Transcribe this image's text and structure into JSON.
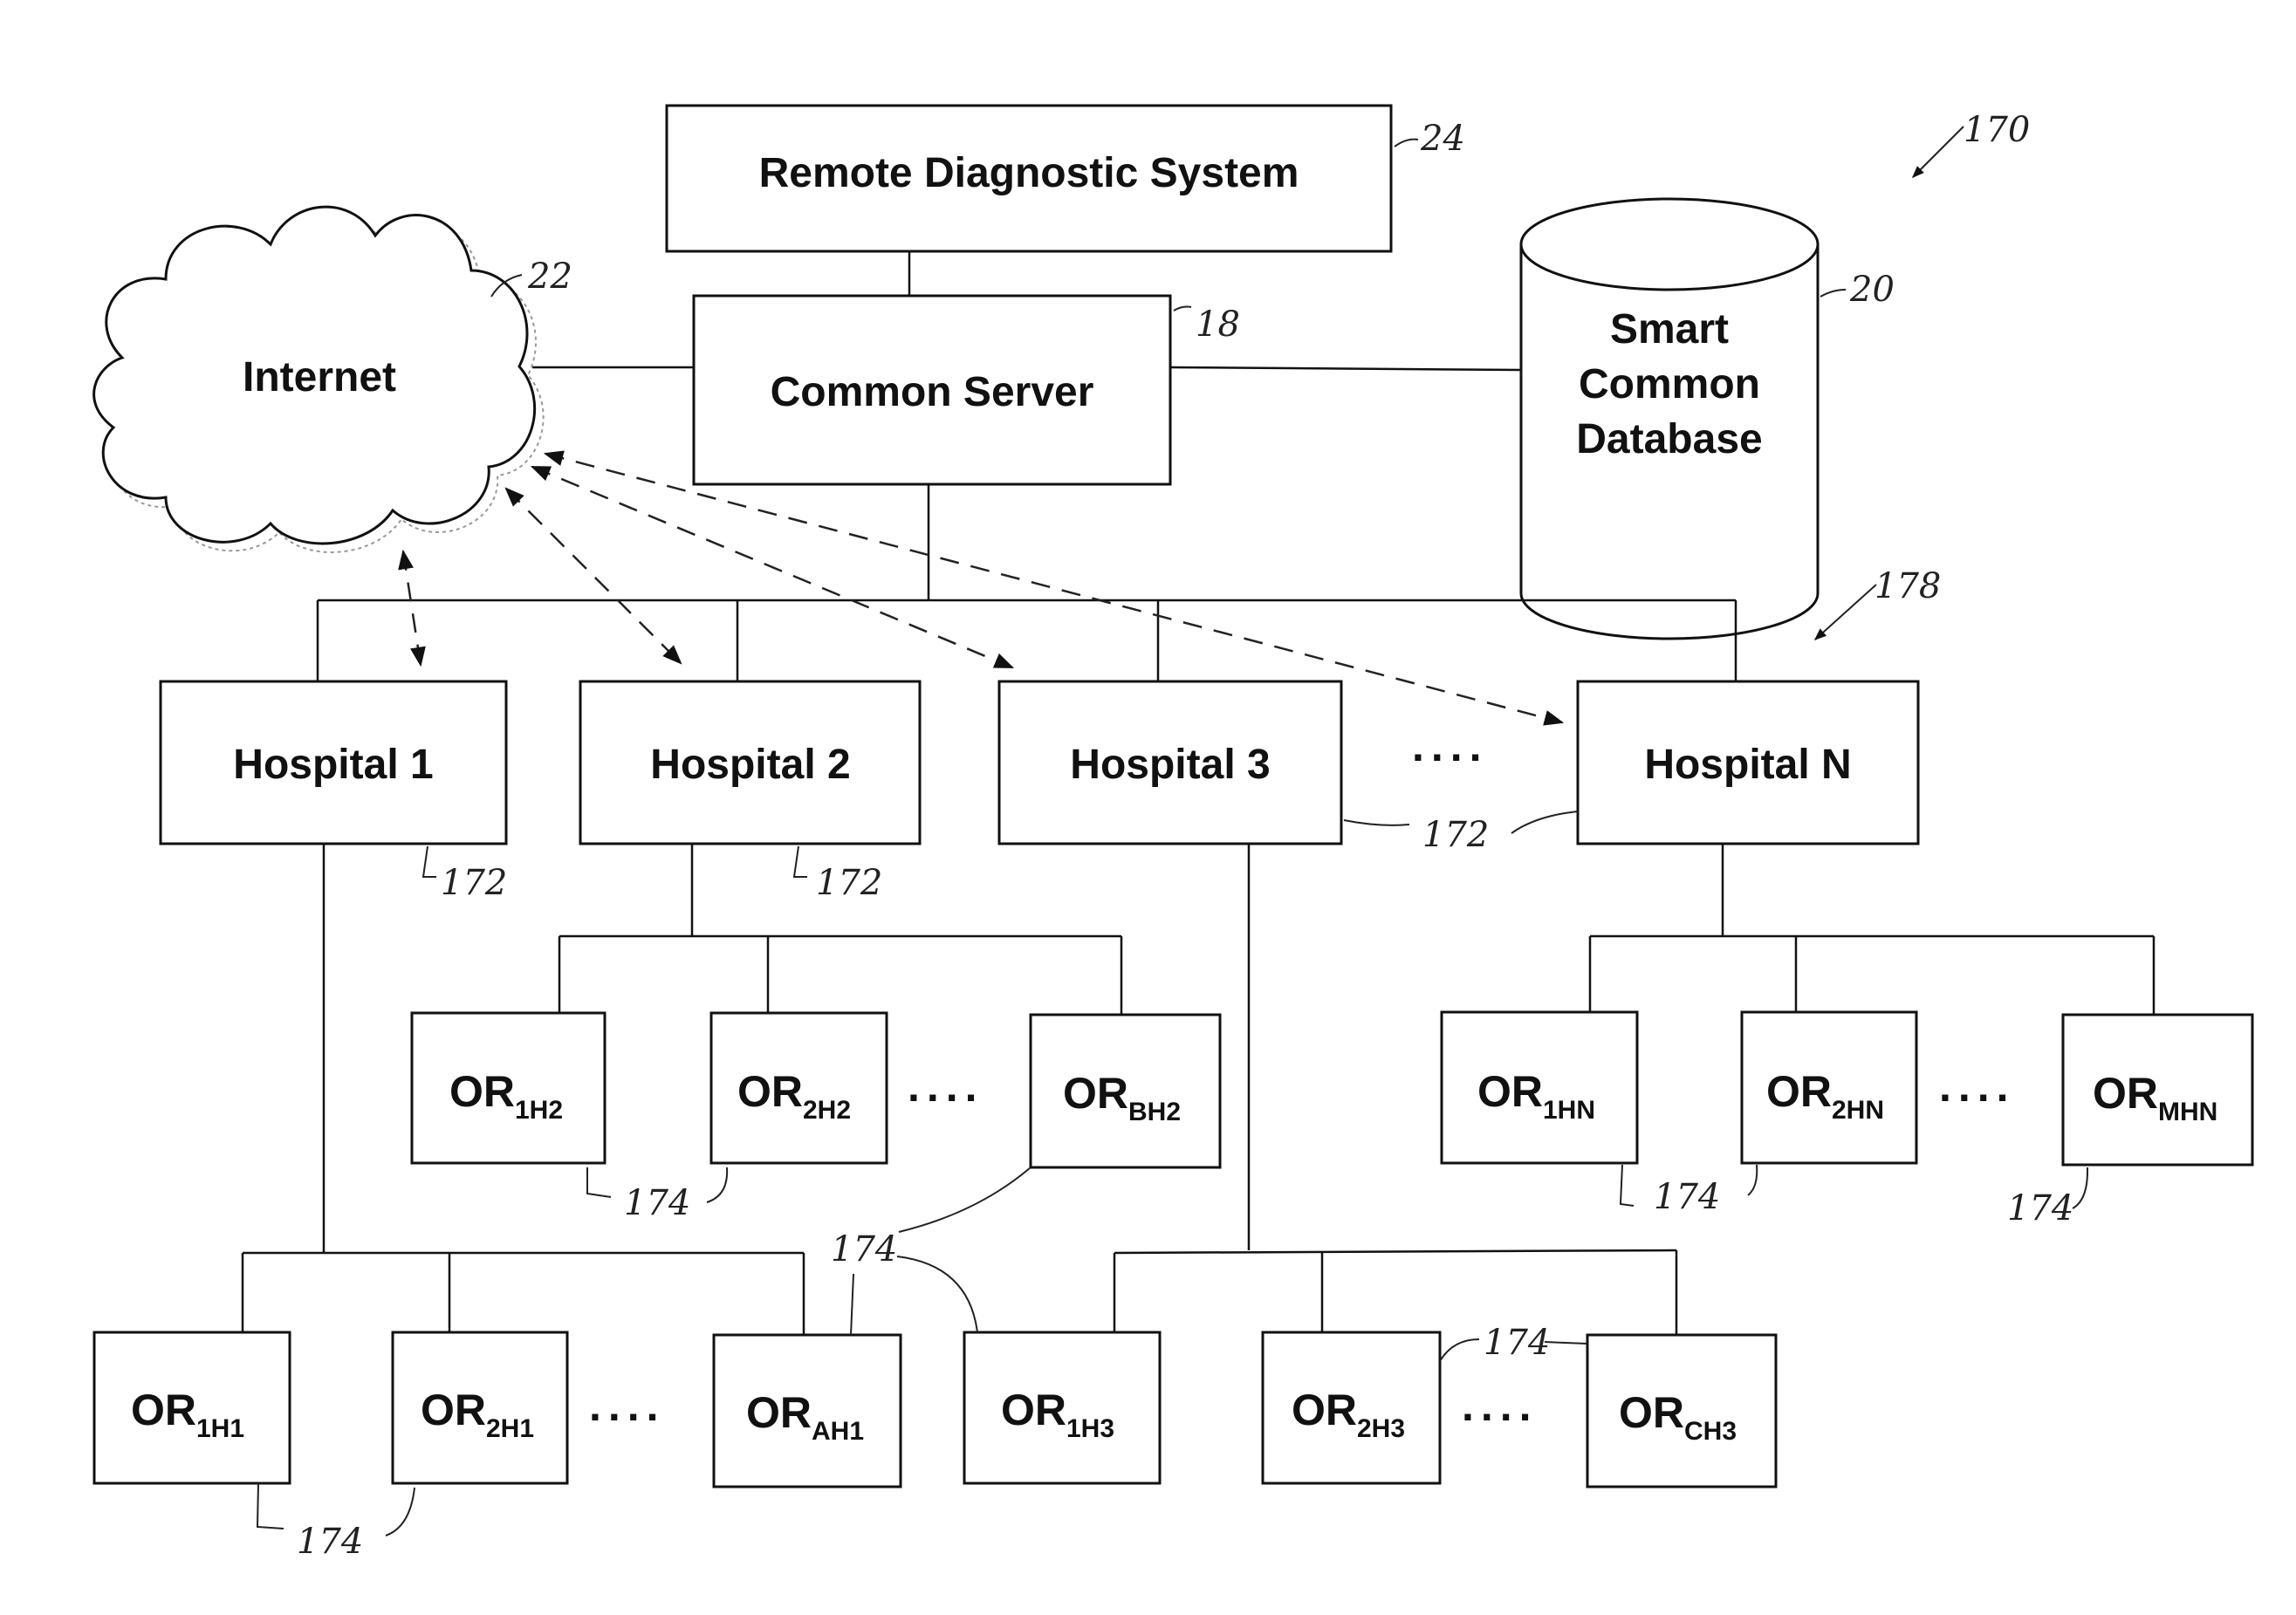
{
  "figure": {
    "ref": "170",
    "hospital_group_ref": "178"
  },
  "nodes": {
    "remote_diagnostic": {
      "label": "Remote Diagnostic System",
      "ref": "24"
    },
    "common_server": {
      "label": "Common Server",
      "ref": "18"
    },
    "internet": {
      "label": "Internet",
      "ref": "22"
    },
    "database": {
      "lines": [
        "Smart",
        "Common",
        "Database"
      ],
      "ref": "20"
    }
  },
  "hospitals": [
    {
      "id": "h1",
      "label": "Hospital 1",
      "ref": "172"
    },
    {
      "id": "h2",
      "label": "Hospital 2",
      "ref": "172"
    },
    {
      "id": "h3",
      "label": "Hospital 3",
      "ref": "172"
    },
    {
      "id": "hn",
      "label": "Hospital N",
      "ref": "172"
    }
  ],
  "ellipsis": "....",
  "operating_rooms": {
    "ref": "174",
    "h1": [
      {
        "main": "OR",
        "sub": "1H1"
      },
      {
        "main": "OR",
        "sub": "2H1"
      },
      {
        "main": "OR",
        "sub": "AH1"
      }
    ],
    "h2": [
      {
        "main": "OR",
        "sub": "1H2"
      },
      {
        "main": "OR",
        "sub": "2H2"
      },
      {
        "main": "OR",
        "sub": "BH2"
      }
    ],
    "h3": [
      {
        "main": "OR",
        "sub": "1H3"
      },
      {
        "main": "OR",
        "sub": "2H3"
      },
      {
        "main": "OR",
        "sub": "CH3"
      }
    ],
    "hn": [
      {
        "main": "OR",
        "sub": "1HN"
      },
      {
        "main": "OR",
        "sub": "2HN"
      },
      {
        "main": "OR",
        "sub": "MHN"
      }
    ]
  }
}
